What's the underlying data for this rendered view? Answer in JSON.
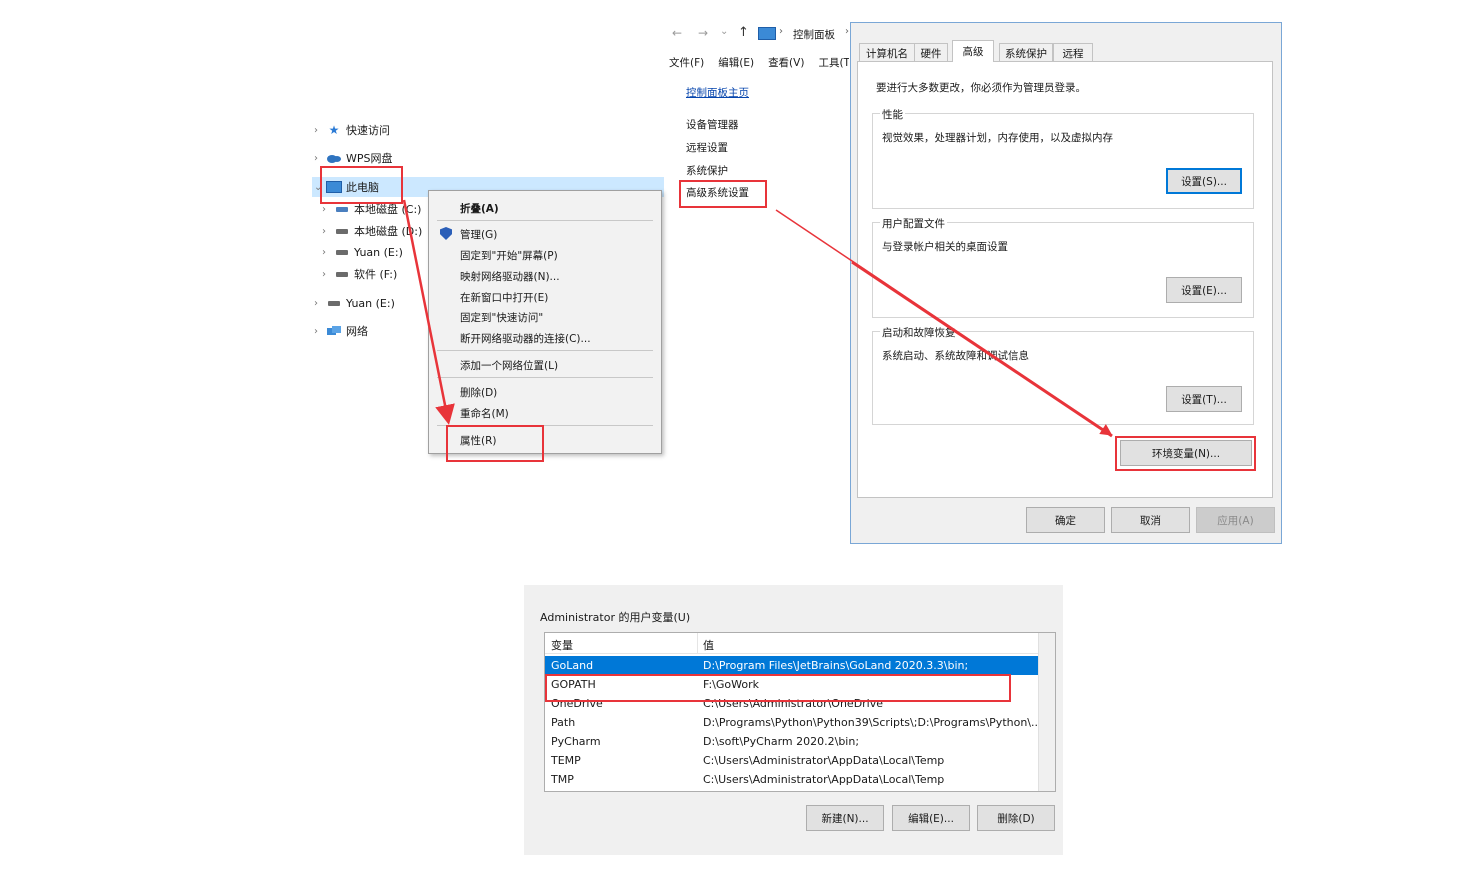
{
  "explorer": {
    "tree": [
      {
        "label": "快速访问",
        "icon": "star-icon"
      },
      {
        "label": "WPS网盘",
        "icon": "cloud-icon"
      },
      {
        "label": "此电脑",
        "icon": "computer-icon"
      },
      {
        "label": "本地磁盘 (C:)",
        "icon": "windows-drive-icon"
      },
      {
        "label": "本地磁盘 (D:)",
        "icon": "drive-icon"
      },
      {
        "label": "Yuan (E:)",
        "icon": "drive-icon"
      },
      {
        "label": "软件 (F:)",
        "icon": "drive-icon"
      },
      {
        "label": "Yuan (E:)",
        "icon": "drive-icon"
      },
      {
        "label": "网络",
        "icon": "network-icon"
      }
    ]
  },
  "context_menu": {
    "collapse": "折叠(A)",
    "manage": "管理(G)",
    "pin_start": "固定到\"开始\"屏幕(P)",
    "map_drive": "映射网络驱动器(N)...",
    "open_new": "在新窗口中打开(E)",
    "pin_quick": "固定到\"快速访问\"",
    "disconnect": "断开网络驱动器的连接(C)...",
    "add_location": "添加一个网络位置(L)",
    "delete": "删除(D)",
    "rename": "重命名(M)",
    "properties": "属性(R)"
  },
  "control_panel": {
    "breadcrumb": "控制面板",
    "menu": [
      "文件(F)",
      "编辑(E)",
      "查看(V)",
      "工具(T)"
    ],
    "home_link": "控制面板主页",
    "side_links": [
      "设备管理器",
      "远程设置",
      "系统保护",
      "高级系统设置"
    ]
  },
  "system_properties": {
    "tabs": [
      "计算机名",
      "硬件",
      "高级",
      "系统保护",
      "远程"
    ],
    "active_tab": "高级",
    "admin_note": "要进行大多数更改，你必须作为管理员登录。",
    "performance": {
      "title": "性能",
      "desc": "视觉效果，处理器计划，内存使用，以及虚拟内存",
      "button": "设置(S)..."
    },
    "user_profiles": {
      "title": "用户配置文件",
      "desc": "与登录帐户相关的桌面设置",
      "button": "设置(E)..."
    },
    "startup_recovery": {
      "title": "启动和故障恢复",
      "desc": "系统启动、系统故障和调试信息",
      "button": "设置(T)..."
    },
    "env_button": "环境变量(N)...",
    "ok": "确定",
    "cancel": "取消",
    "apply": "应用(A)"
  },
  "env_vars": {
    "title": "Administrator 的用户变量(U)",
    "headers": {
      "var": "变量",
      "value": "值"
    },
    "rows": [
      {
        "var": "GoLand",
        "value": "D:\\Program Files\\JetBrains\\GoLand 2020.3.3\\bin;"
      },
      {
        "var": "GOPATH",
        "value": "F:\\GoWork"
      },
      {
        "var": "OneDrive",
        "value": "C:\\Users\\Administrator\\OneDrive"
      },
      {
        "var": "Path",
        "value": "D:\\Programs\\Python\\Python39\\Scripts\\;D:\\Programs\\Python\\..."
      },
      {
        "var": "PyCharm",
        "value": "D:\\soft\\PyCharm 2020.2\\bin;"
      },
      {
        "var": "TEMP",
        "value": "C:\\Users\\Administrator\\AppData\\Local\\Temp"
      },
      {
        "var": "TMP",
        "value": "C:\\Users\\Administrator\\AppData\\Local\\Temp"
      }
    ],
    "selected_row": 0,
    "buttons": {
      "new": "新建(N)...",
      "edit": "编辑(E)...",
      "delete": "删除(D)"
    }
  },
  "colors": {
    "annotation_red": "#e8343a",
    "selection_blue": "#0078d7",
    "link_blue": "#0645ad"
  }
}
